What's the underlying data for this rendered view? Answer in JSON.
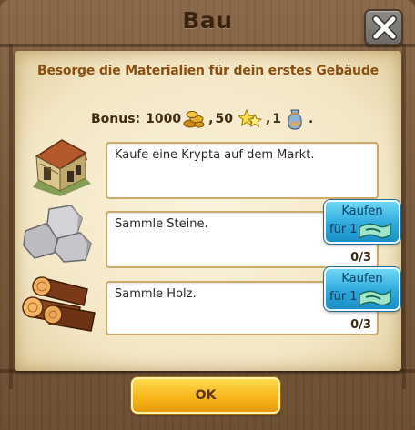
{
  "dialog": {
    "title": "Bau",
    "subtitle": "Besorge die Materialien für dein erstes Gebäude",
    "close_icon": "close-x-icon"
  },
  "bonus": {
    "label": "Bonus:",
    "coins": "1000",
    "xp": "50",
    "third_reward": "1",
    "end": "."
  },
  "tasks": [
    {
      "icon": "crypt-building-icon",
      "text": "Kaufe eine Krypta auf dem Markt.",
      "progress": "",
      "has_buy_button": false
    },
    {
      "icon": "stone-blocks-icon",
      "text": "Sammle Steine.",
      "progress": "0/3",
      "has_buy_button": true
    },
    {
      "icon": "wood-logs-icon",
      "text": "Sammle Holz.",
      "progress": "0/3",
      "has_buy_button": true
    }
  ],
  "buy_button": {
    "label": "Kaufen",
    "price_prefix": "für 1",
    "currency_icon": "banknote-icon"
  },
  "ok_button": {
    "label": "OK"
  },
  "colors": {
    "wood": "#7a5a3c",
    "parchment": "#f3e6c4",
    "subtitle": "#8a4e12",
    "buy_button": "#2ea9dc",
    "ok_button": "#f6b41a"
  }
}
